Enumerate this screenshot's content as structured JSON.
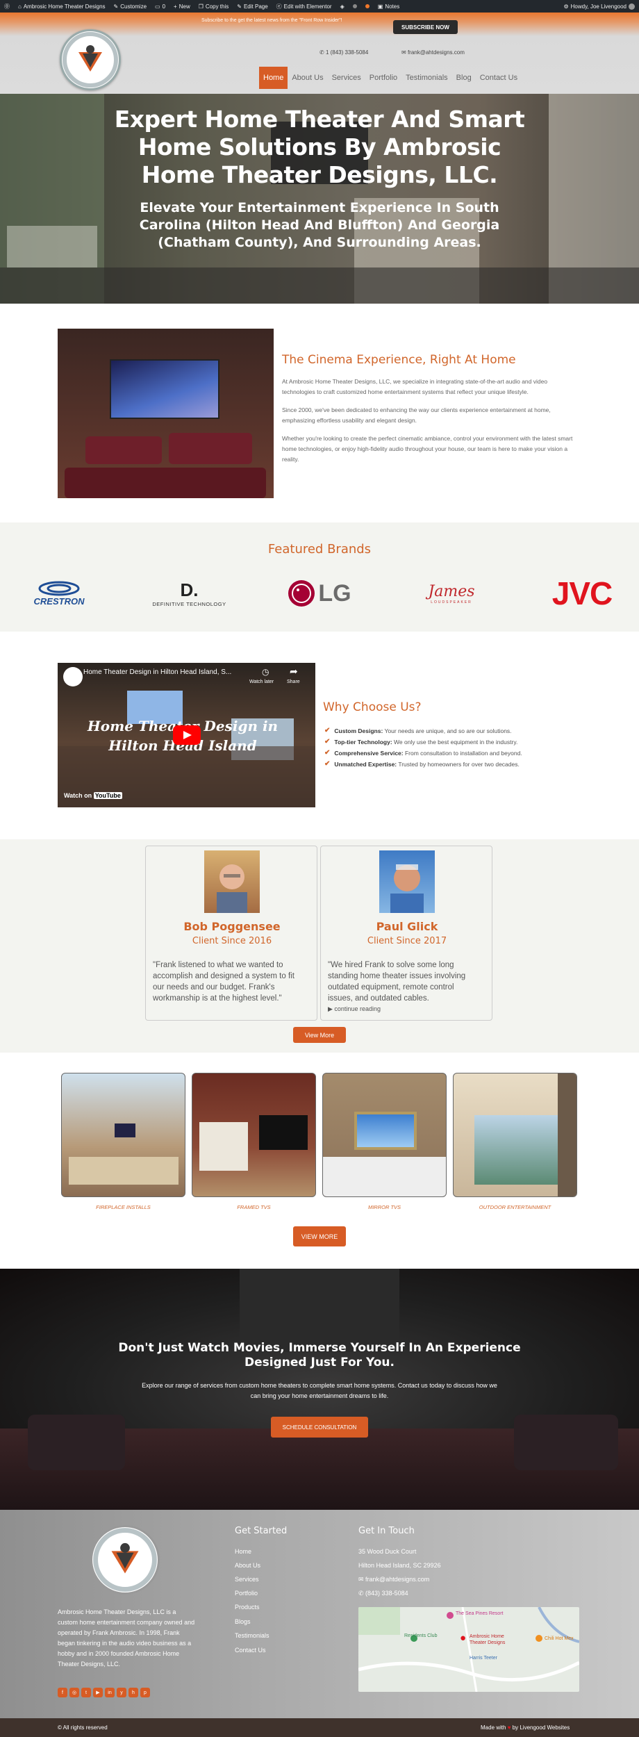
{
  "adminbar": {
    "site": "Ambrosic Home Theater Designs",
    "customize": "Customize",
    "comments": "0",
    "new": "New",
    "copy": "Copy this",
    "edit": "Edit Page",
    "elementor": "Edit with Elementor",
    "notes": "Notes",
    "howdy": "Howdy, Joe Livengood"
  },
  "header": {
    "subscribe_text": "Subscribe to the get the latest news from the \"Front Row Insider\"!",
    "subscribe_button": "SUBSCRIBE NOW",
    "phone": "1 (843) 338-5084",
    "email": "frank@ahtdesigns.com",
    "logo_text": "Ambrosic Home Theater Designs",
    "nav": [
      "Home",
      "About Us",
      "Services",
      "Portfolio",
      "Testimonials",
      "Blog",
      "Contact Us"
    ]
  },
  "hero": {
    "title": "Expert Home Theater And Smart Home Solutions By Ambrosic Home Theater Designs, LLC.",
    "subtitle": "Elevate Your Entertainment Experience In South Carolina (Hilton Head And Bluffton) And Georgia (Chatham County), And Surrounding Areas."
  },
  "about": {
    "title": "The Cinema Experience, Right At Home",
    "p1": "At Ambrosic Home Theater Designs, LLC, we specialize in integrating state-of-the-art audio and video technologies to craft customized home entertainment systems that reflect your unique lifestyle.",
    "p2": "Since 2000, we've been dedicated to enhancing the way our clients experience entertainment at home, emphasizing effortless usability and elegant design.",
    "p3": "Whether you're looking to create the perfect cinematic ambiance, control your environment with the latest smart home technologies, or enjoy high-fidelity audio throughout your house, our team is here to make your vision a reality."
  },
  "brands": {
    "title": "Featured Brands",
    "items": [
      {
        "name": "CRESTRON",
        "color": "#1f4e96"
      },
      {
        "name": "D.",
        "sub": "DEFINITIVE TECHNOLOGY",
        "color": "#222222"
      },
      {
        "name": "LG",
        "color": "#a50034"
      },
      {
        "name": "James",
        "sub": "LOUDSPEAKER",
        "color": "#c0282d"
      },
      {
        "name": "JVC",
        "color": "#e0141e"
      }
    ]
  },
  "video": {
    "title": "Home Theater Design in Hilton Head Island, S...",
    "overlay": "Home Theater Design in Hilton Head Island",
    "watch_later": "Watch later",
    "share": "Share",
    "watch_on": "Watch on",
    "youtube": "YouTube"
  },
  "why": {
    "title": "Why Choose Us?",
    "items": [
      {
        "bold": "Custom Designs:",
        "text": " Your needs are unique, and so are our solutions."
      },
      {
        "bold": "Top-tier Technology:",
        "text": " We only use the best equipment in the industry."
      },
      {
        "bold": "Comprehensive Service:",
        "text": " From consultation to installation and beyond."
      },
      {
        "bold": "Unmatched Expertise:",
        "text": " Trusted by homeowners for over two decades."
      }
    ]
  },
  "testimonials": {
    "items": [
      {
        "name": "Bob Poggensee",
        "since": "Client Since 2016",
        "quote": "\"Frank listened to what we wanted to accomplish and designed a system to fit our needs and our budget. Frank's workmanship is at the highest level.\""
      },
      {
        "name": "Paul Glick",
        "since": "Client Since 2017",
        "quote": "\"We hired Frank to solve some long standing home theater issues involving outdated equipment, remote control issues, and outdated cables.",
        "more": "continue reading"
      }
    ],
    "view_more": "View More"
  },
  "gallery": {
    "items": [
      "FIREPLACE INSTALLS",
      "FRAMED TVS",
      "MIRROR TVS",
      "OUTDOOR ENTERTAINMENT"
    ],
    "button": "VIEW MORE"
  },
  "cta": {
    "title": "Don't Just Watch Movies, Immerse Yourself In An Experience Designed Just For You.",
    "text": "Explore our range of services from custom home theaters to complete smart home systems. Contact us today to discuss how we can bring your home entertainment dreams to life.",
    "button": "SCHEDULE CONSULTATION"
  },
  "footer": {
    "about": "Ambrosic Home Theater Designs, LLC is a custom home entertainment company owned and operated by Frank Ambrosic. In 1998, Frank began tinkering in the audio video business as a hobby and in 2000 founded Ambrosic Home Theater Designs, LLC.",
    "started_title": "Get Started",
    "links": [
      "Home",
      "About Us",
      "Services",
      "Portfolio",
      "Products",
      "Blogs",
      "Testimonials",
      "Contact Us"
    ],
    "touch_title": "Get In Touch",
    "address1": "35 Wood Duck Court",
    "address2": "Hilton Head Island, SC 29926",
    "email": "frank@ahtdesigns.com",
    "phone": "(843) 338-5084",
    "map_labels": [
      "The Sea Pines Resort",
      "Residents Club",
      "Ambrosic Home Theater Designs",
      "Harris Teeter",
      "Chili Hot Mex"
    ],
    "social_icons": [
      "facebook-icon",
      "instagram-icon",
      "twitter-icon",
      "youtube-icon",
      "linkedin-icon",
      "yelp-icon",
      "houzz-icon",
      "pinterest-icon"
    ],
    "copyright": "© All rights reserved",
    "made_with": "Made with",
    "made_by": "by Livengood Websites"
  },
  "colors": {
    "accent": "#d75c25",
    "title": "#d1662b",
    "admin": "#23282d",
    "footerbar": "#3f322c"
  }
}
